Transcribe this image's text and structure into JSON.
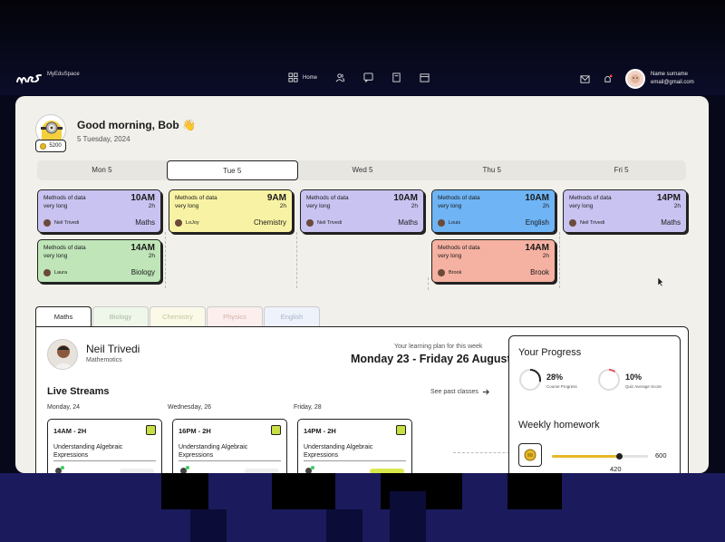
{
  "brand": {
    "name": "MyEduSpace"
  },
  "nav": {
    "items": [
      {
        "icon": "grid-icon",
        "label": "Home"
      },
      {
        "icon": "users-icon",
        "label": ""
      },
      {
        "icon": "chat-icon",
        "label": ""
      },
      {
        "icon": "book-icon",
        "label": ""
      },
      {
        "icon": "calendar-icon",
        "label": ""
      }
    ]
  },
  "user": {
    "name": "Name surname",
    "email": "email@gmail.com"
  },
  "greeting": {
    "text": "Good morning, Bob 👋",
    "date": "5 Tuesday, 2024",
    "coins": "5200"
  },
  "days": [
    {
      "label": "Mon 5",
      "active": false
    },
    {
      "label": "Tue 5",
      "active": true
    },
    {
      "label": "Wed 5",
      "active": false
    },
    {
      "label": "Thu 5",
      "active": false
    },
    {
      "label": "Fri 5",
      "active": false
    }
  ],
  "events": [
    {
      "title": "Methods of data",
      "title2": "very long",
      "time": "10AM",
      "duration": "2h",
      "teacher": "Neil Trivedi",
      "subject": "Maths",
      "color": "#c9c3f1"
    },
    {
      "title": "Methods of data",
      "title2": "very long",
      "time": "14AM",
      "duration": "2h",
      "teacher": "Laura",
      "subject": "Biology",
      "color": "#bfe5b8"
    },
    {
      "title": "Methods of data",
      "title2": "very long",
      "time": "9AM",
      "duration": "2h",
      "teacher": "LoJoy",
      "subject": "Chemistry",
      "color": "#f8f3a4"
    },
    {
      "title": "Methods of data",
      "title2": "very long",
      "time": "10AM",
      "duration": "2h",
      "teacher": "Neil Trivedi",
      "subject": "Maths",
      "color": "#c9c3f1"
    },
    {
      "title": "Methods of data",
      "title2": "very long",
      "time": "10AM",
      "duration": "2h",
      "teacher": "Louis",
      "subject": "English",
      "color": "#6fb4f5"
    },
    {
      "title": "Methods of data",
      "title2": "very long",
      "time": "14AM",
      "duration": "2h",
      "teacher": "Brook",
      "subject": "Brook",
      "color": "#f5b1a1"
    },
    {
      "title": "Methods of data",
      "title2": "very long",
      "time": "14PM",
      "duration": "2h",
      "teacher": "Neil Trivedi",
      "subject": "Maths",
      "color": "#c9c3f1"
    }
  ],
  "tabs": [
    "Maths",
    "Biology",
    "Chemistry",
    "Physics",
    "English"
  ],
  "teacher": {
    "name": "Neil Trivedi",
    "subject": "Mathemotics"
  },
  "plan": {
    "label": "Your learning plan for this week",
    "range": "Monday 23 - Friday 26 August"
  },
  "live": {
    "title": "Live Streams",
    "past_link": "See past classes",
    "days": [
      {
        "day": "Monday, 24",
        "time": "14AM - 2H",
        "title": "Understanding Algebraic",
        "title2": "Expressions"
      },
      {
        "day": "Wednesday, 26",
        "time": "16PM - 2H",
        "title": "Understanding Algebraic",
        "title2": "Expressions"
      },
      {
        "day": "Friday, 28",
        "time": "14PM - 2H",
        "title": "Understanding Algebraic",
        "title2": "Expressions"
      }
    ]
  },
  "progress": {
    "title": "Your Progress",
    "course": {
      "value": "28%",
      "label": "Course Progress",
      "fraction": 0.28
    },
    "quiz": {
      "value": "10%",
      "label": "Quiz Average Score",
      "fraction": 0.1
    }
  },
  "homework": {
    "title": "Weekly homework",
    "current": "420",
    "max": "600",
    "fraction": 0.7
  }
}
